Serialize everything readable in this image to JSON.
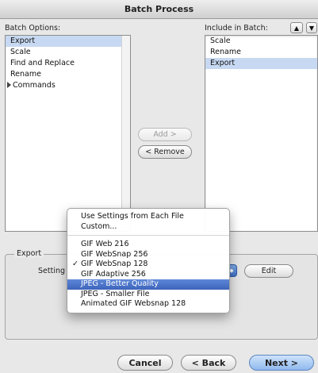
{
  "window": {
    "title": "Batch Process"
  },
  "batch_options": {
    "label": "Batch Options:",
    "items": [
      {
        "label": "Export",
        "selected": true
      },
      {
        "label": "Scale",
        "selected": false
      },
      {
        "label": "Find and Replace",
        "selected": false
      },
      {
        "label": "Rename",
        "selected": false
      },
      {
        "label": "Commands",
        "selected": false,
        "expandable": true
      }
    ]
  },
  "include": {
    "label": "Include in Batch:",
    "items": [
      {
        "label": "Scale",
        "selected": false
      },
      {
        "label": "Rename",
        "selected": false
      },
      {
        "label": "Export",
        "selected": true
      }
    ]
  },
  "buttons": {
    "add": "Add >",
    "remove": "< Remove",
    "edit": "Edit",
    "cancel": "Cancel",
    "back": "< Back",
    "next": "Next >"
  },
  "export_group": {
    "title": "Export",
    "settings_label": "Setting"
  },
  "menu": {
    "top_items": [
      "Use Settings from Each File",
      "Custom..."
    ],
    "items": [
      {
        "label": "GIF Web 216",
        "checked": false,
        "highlighted": false
      },
      {
        "label": "GIF WebSnap 256",
        "checked": false,
        "highlighted": false
      },
      {
        "label": "GIF WebSnap 128",
        "checked": true,
        "highlighted": false
      },
      {
        "label": "GIF Adaptive 256",
        "checked": false,
        "highlighted": false
      },
      {
        "label": "JPEG - Better Quality",
        "checked": false,
        "highlighted": true
      },
      {
        "label": "JPEG - Smaller File",
        "checked": false,
        "highlighted": false
      },
      {
        "label": "Animated GIF Websnap 128",
        "checked": false,
        "highlighted": false
      }
    ],
    "check_glyph": "✓"
  },
  "colors": {
    "selection": "#c7d9f2",
    "menu_highlight": "#3d64bc",
    "default_button": "#8fb9ee"
  },
  "icons": {
    "up": "▲",
    "down": "▼",
    "popup": "◆"
  }
}
